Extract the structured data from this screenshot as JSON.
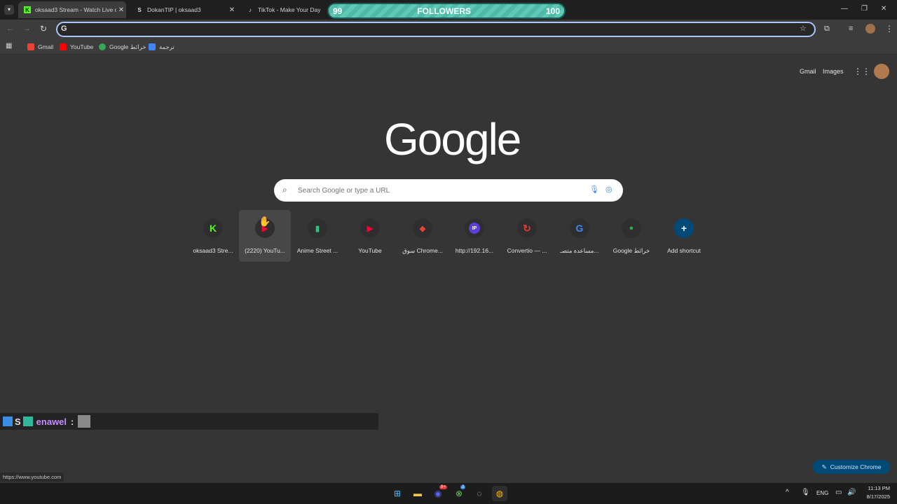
{
  "tabs": [
    {
      "title": "oksaad3 Stream - Watch Live on",
      "icon": "kick-icon"
    },
    {
      "title": "DokanTIP | oksaad3",
      "icon": "dokantip-icon"
    },
    {
      "title": "TikTok - Make Your Day",
      "icon": "tiktok-icon"
    }
  ],
  "followers": {
    "current": "99",
    "label": "FOLLOWERS",
    "goal": "100"
  },
  "omnibox": {
    "value": "",
    "icon": "google-g-icon"
  },
  "bookmarks": [
    {
      "label": "Gmail",
      "color": "#ea4335"
    },
    {
      "label": "YouTube",
      "color": "#ff0000"
    },
    {
      "label": "Google خرائط",
      "color": "#34a853"
    },
    {
      "label": "ترجمة",
      "color": "#4285f4"
    }
  ],
  "header_links": {
    "gmail": "Gmail",
    "images": "Images"
  },
  "logo": "Google",
  "search": {
    "placeholder": "Search Google or type a URL"
  },
  "shortcuts": [
    {
      "label": "oksaad3 Stre...",
      "glyph": "K",
      "color": "#53fc18"
    },
    {
      "label": "(2220) YouTu...",
      "glyph": "▶",
      "color": "#ff0033"
    },
    {
      "label": "Anime Street ...",
      "glyph": "▮",
      "color": "#2ec27e"
    },
    {
      "label": "YouTube",
      "glyph": "▶",
      "color": "#ff0033"
    },
    {
      "label": "سوق Chrome...",
      "glyph": "◆",
      "color": "#ea4335"
    },
    {
      "label": "http://192.16...",
      "glyph": "IP",
      "color": "#5b3fd6"
    },
    {
      "label": "Convertio — ...",
      "glyph": "↻",
      "color": "#e53935"
    },
    {
      "label": "مساعدة متصـ...",
      "glyph": "G",
      "color": "#4285f4"
    },
    {
      "label": "Google خرائط",
      "glyph": "●",
      "color": "#34a853"
    },
    {
      "label": "Add shortcut",
      "glyph": "+",
      "color": "#ffffff"
    }
  ],
  "chat": {
    "user": "enawel",
    "sep": ":",
    "prefix": "S"
  },
  "customize_label": "Customize Chrome",
  "status_url": "https://www.youtube.com",
  "taskbar": {
    "lang": "ENG",
    "time": "11:13 PM",
    "date": "8/17/2025",
    "discord_badge": "9+",
    "xbox_badge": "2"
  }
}
